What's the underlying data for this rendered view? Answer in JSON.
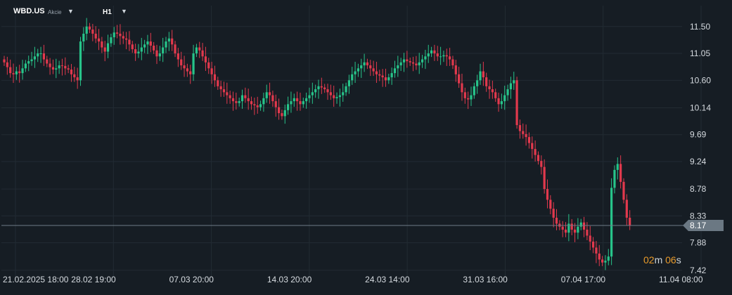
{
  "header": {
    "symbol": "WBD.US",
    "instrument_type": "Akcie",
    "timeframe": "H1"
  },
  "timer": {
    "minutes": "02",
    "minutes_unit": "m",
    "seconds": "06",
    "seconds_unit": "s"
  },
  "colors": {
    "bull": "#27c48a",
    "bear": "#e2394d",
    "background": "#161d24",
    "grid": "#222b33",
    "price_line": "#6f7c87",
    "price_label_bg": "#6b7883",
    "timer": "#e79a2b"
  },
  "chart_data": {
    "type": "candlestick",
    "symbol": "WBD.US",
    "timeframe": "H1",
    "grid": true,
    "y_axis_position": "right",
    "ylim": [
      7.3,
      11.85
    ],
    "y_ticks": [
      "11.50",
      "11.05",
      "10.60",
      "10.14",
      "9.69",
      "9.24",
      "8.78",
      "8.33",
      "7.88",
      "7.42"
    ],
    "x_ticks": [
      "21.02.2025  18:00",
      "28.02  19:00",
      "07.03  20:00",
      "14.03  20:00",
      "24.03  14:00",
      "31.03  16:00",
      "07.04  17:00",
      "11.04  08:00"
    ],
    "current_price": "8.17",
    "closes": [
      10.9,
      10.82,
      10.72,
      10.7,
      10.75,
      10.72,
      10.8,
      10.88,
      10.92,
      10.95,
      11.0,
      11.05,
      11.05,
      10.95,
      10.88,
      10.82,
      10.78,
      10.8,
      10.85,
      10.84,
      10.8,
      10.78,
      10.7,
      10.65,
      10.6,
      11.25,
      11.38,
      11.5,
      11.45,
      11.38,
      11.3,
      11.25,
      11.15,
      11.08,
      11.22,
      11.32,
      11.4,
      11.38,
      11.34,
      11.3,
      11.28,
      11.2,
      11.12,
      11.05,
      11.08,
      11.15,
      11.2,
      11.25,
      11.18,
      11.1,
      11.0,
      11.05,
      11.15,
      11.25,
      11.3,
      11.2,
      11.05,
      10.95,
      10.85,
      10.8,
      10.75,
      10.7,
      11.05,
      11.15,
      11.1,
      11.0,
      10.9,
      10.8,
      10.7,
      10.6,
      10.5,
      10.45,
      10.4,
      10.35,
      10.3,
      10.25,
      10.22,
      10.25,
      10.35,
      10.3,
      10.25,
      10.2,
      10.18,
      10.15,
      10.2,
      10.3,
      10.4,
      10.35,
      10.25,
      10.15,
      10.05,
      10.0,
      10.1,
      10.2,
      10.25,
      10.3,
      10.25,
      10.2,
      10.25,
      10.3,
      10.35,
      10.4,
      10.45,
      10.5,
      10.48,
      10.45,
      10.4,
      10.35,
      10.3,
      10.32,
      10.35,
      10.4,
      10.5,
      10.6,
      10.7,
      10.75,
      10.8,
      10.85,
      10.9,
      10.85,
      10.8,
      10.75,
      10.7,
      10.68,
      10.65,
      10.6,
      10.65,
      10.72,
      10.8,
      10.85,
      10.9,
      10.95,
      10.92,
      10.9,
      10.88,
      10.85,
      10.9,
      10.95,
      11.0,
      11.05,
      11.1,
      11.05,
      11.0,
      11.0,
      11.02,
      11.0,
      10.95,
      10.85,
      10.7,
      10.55,
      10.4,
      10.3,
      10.28,
      10.35,
      10.5,
      10.6,
      10.75,
      10.65,
      10.5,
      10.45,
      10.4,
      10.3,
      10.2,
      10.25,
      10.35,
      10.45,
      10.55,
      10.6,
      9.85,
      9.75,
      9.7,
      9.65,
      9.55,
      9.45,
      9.35,
      9.25,
      9.15,
      8.78,
      8.6,
      8.45,
      8.3,
      8.2,
      8.15,
      8.1,
      8.05,
      8.2,
      8.1,
      8.05,
      8.15,
      8.22,
      8.1,
      8.0,
      7.9,
      7.8,
      7.7,
      7.6,
      7.55,
      7.58,
      7.65,
      8.8,
      9.1,
      9.2,
      8.9,
      8.6,
      8.3,
      8.17
    ]
  }
}
